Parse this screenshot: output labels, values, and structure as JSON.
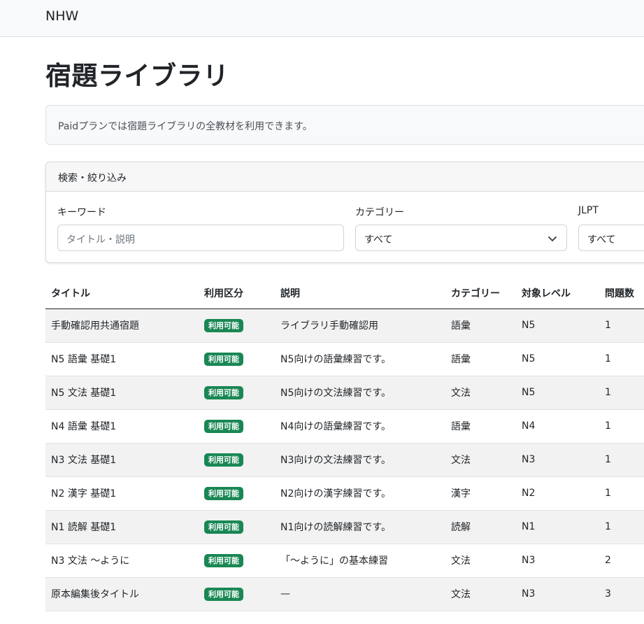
{
  "navbar": {
    "brand": "NHW"
  },
  "page": {
    "title": "宿題ライブラリ"
  },
  "notice": {
    "text": "Paidプランでは宿題ライブラリの全教材を利用できます。"
  },
  "filters": {
    "header": "検索・絞り込み",
    "keyword": {
      "label": "キーワード",
      "placeholder": "タイトル・説明",
      "value": ""
    },
    "category": {
      "label": "カテゴリー",
      "selected": "すべて"
    },
    "jlpt": {
      "label": "JLPT",
      "selected": "すべて"
    }
  },
  "colors": {
    "badge": "#198754",
    "navbar_bg": "#f8f9fa"
  },
  "table": {
    "headers": {
      "title": "タイトル",
      "access": "利用区分",
      "description": "説明",
      "category": "カテゴリー",
      "level": "対象レベル",
      "count": "問題数"
    },
    "rows": [
      {
        "title": "手動確認用共通宿題",
        "badge": "利用可能",
        "description": "ライブラリ手動確認用",
        "category": "語彙",
        "level": "N5",
        "count": "1"
      },
      {
        "title": "N5 語彙 基礎1",
        "badge": "利用可能",
        "description": "N5向けの語彙練習です。",
        "category": "語彙",
        "level": "N5",
        "count": "1"
      },
      {
        "title": "N5 文法 基礎1",
        "badge": "利用可能",
        "description": "N5向けの文法練習です。",
        "category": "文法",
        "level": "N5",
        "count": "1"
      },
      {
        "title": "N4 語彙 基礎1",
        "badge": "利用可能",
        "description": "N4向けの語彙練習です。",
        "category": "語彙",
        "level": "N4",
        "count": "1"
      },
      {
        "title": "N3 文法 基礎1",
        "badge": "利用可能",
        "description": "N3向けの文法練習です。",
        "category": "文法",
        "level": "N3",
        "count": "1"
      },
      {
        "title": "N2 漢字 基礎1",
        "badge": "利用可能",
        "description": "N2向けの漢字練習です。",
        "category": "漢字",
        "level": "N2",
        "count": "1"
      },
      {
        "title": "N1 読解 基礎1",
        "badge": "利用可能",
        "description": "N1向けの読解練習です。",
        "category": "読解",
        "level": "N1",
        "count": "1"
      },
      {
        "title": "N3 文法 〜ように",
        "badge": "利用可能",
        "description": "「〜ように」の基本練習",
        "category": "文法",
        "level": "N3",
        "count": "2"
      },
      {
        "title": "原本編集後タイトル",
        "badge": "利用可能",
        "description": "—",
        "category": "文法",
        "level": "N3",
        "count": "3"
      }
    ]
  }
}
